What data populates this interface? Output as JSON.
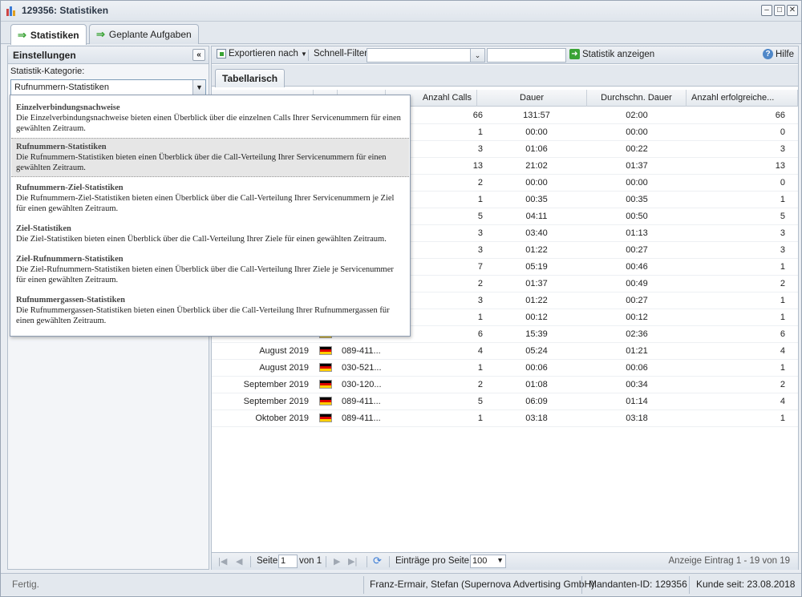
{
  "window": {
    "title": "129356: Statistiken"
  },
  "tabs": [
    {
      "label": "Statistiken",
      "active": true
    },
    {
      "label": "Geplante Aufgaben",
      "active": false
    }
  ],
  "settings": {
    "header": "Einstellungen",
    "category_label": "Statistik-Kategorie:",
    "selected": "Rufnummern-Statistiken"
  },
  "dropdown": [
    {
      "title": "Einzelverbindungsnachweise",
      "desc": "Die Einzelverbindungsnachweise bieten einen Überblick über die einzelnen Calls Ihrer Servicenummern für einen gewählten Zeitraum."
    },
    {
      "title": "Rufnummern-Statistiken",
      "desc": "Die Rufnummern-Statistiken bieten einen Überblick über die Call-Verteilung Ihrer Servicenummern für einen gewählten Zeitraum."
    },
    {
      "title": "Rufnummern-Ziel-Statistiken",
      "desc": "Die Rufnummern-Ziel-Statistiken bieten einen Überblick über die Call-Verteilung Ihrer Servicenummern je Ziel für einen gewählten Zeitraum."
    },
    {
      "title": "Ziel-Statistiken",
      "desc": "Die Ziel-Statistiken bieten einen Überblick über die Call-Verteilung Ihrer Ziele für einen gewählten Zeitraum."
    },
    {
      "title": "Ziel-Rufnummern-Statistiken",
      "desc": "Die Ziel-Rufnummern-Statistiken bieten einen Überblick über die Call-Verteilung Ihrer Ziele je Servicenummer für einen gewählten Zeitraum."
    },
    {
      "title": "Rufnummergassen-Statistiken",
      "desc": "Die Rufnummergassen-Statistiken bieten einen Überblick über die Call-Verteilung Ihrer Rufnummergassen für einen gewählten Zeitraum."
    }
  ],
  "toolbar": {
    "export": "Exportieren nach",
    "quickfilter": "Schnell-Filter",
    "show_stats": "Statistik anzeigen",
    "help": "Hilfe"
  },
  "subtab": "Tabellarisch",
  "columns": [
    "Anzahl Calls",
    "Dauer",
    "Durchschn. Dauer",
    "Anzahl erfolgreiche..."
  ],
  "rows": [
    {
      "period": "",
      "number": "",
      "calls": "66",
      "duration": "131:57",
      "avg": "02:00",
      "success": "66",
      "flag": false
    },
    {
      "period": "",
      "number": "",
      "calls": "1",
      "duration": "00:00",
      "avg": "00:00",
      "success": "0",
      "flag": false
    },
    {
      "period": "",
      "number": "",
      "calls": "3",
      "duration": "01:06",
      "avg": "00:22",
      "success": "3",
      "flag": false
    },
    {
      "period": "",
      "number": "",
      "calls": "13",
      "duration": "21:02",
      "avg": "01:37",
      "success": "13",
      "flag": false
    },
    {
      "period": "",
      "number": "",
      "calls": "2",
      "duration": "00:00",
      "avg": "00:00",
      "success": "0",
      "flag": false
    },
    {
      "period": "",
      "number": "",
      "calls": "1",
      "duration": "00:35",
      "avg": "00:35",
      "success": "1",
      "flag": false
    },
    {
      "period": "",
      "number": "",
      "calls": "5",
      "duration": "04:11",
      "avg": "00:50",
      "success": "5",
      "flag": false
    },
    {
      "period": "",
      "number": "",
      "calls": "3",
      "duration": "03:40",
      "avg": "01:13",
      "success": "3",
      "flag": false
    },
    {
      "period": "",
      "number": "",
      "calls": "3",
      "duration": "01:22",
      "avg": "00:27",
      "success": "3",
      "flag": false
    },
    {
      "period": "",
      "number": "",
      "calls": "7",
      "duration": "05:19",
      "avg": "00:46",
      "success": "1",
      "flag": false
    },
    {
      "period": "",
      "number": "",
      "calls": "2",
      "duration": "01:37",
      "avg": "00:49",
      "success": "2",
      "flag": false
    },
    {
      "period": "",
      "number": "",
      "calls": "3",
      "duration": "01:22",
      "avg": "00:27",
      "success": "1",
      "flag": false
    },
    {
      "period": "",
      "number": "",
      "calls": "1",
      "duration": "00:12",
      "avg": "00:12",
      "success": "1",
      "flag": false
    },
    {
      "period": "",
      "number": "",
      "calls": "6",
      "duration": "15:39",
      "avg": "02:36",
      "success": "6",
      "flag": true
    },
    {
      "period": "August 2019",
      "number": "089-411...",
      "calls": "4",
      "duration": "05:24",
      "avg": "01:21",
      "success": "4",
      "flag": true
    },
    {
      "period": "August 2019",
      "number": "030-521...",
      "calls": "1",
      "duration": "00:06",
      "avg": "00:06",
      "success": "1",
      "flag": true
    },
    {
      "period": "September 2019",
      "number": "030-120...",
      "calls": "2",
      "duration": "01:08",
      "avg": "00:34",
      "success": "2",
      "flag": true
    },
    {
      "period": "September 2019",
      "number": "089-411...",
      "calls": "5",
      "duration": "06:09",
      "avg": "01:14",
      "success": "4",
      "flag": true
    },
    {
      "period": "Oktober 2019",
      "number": "089-411...",
      "calls": "1",
      "duration": "03:18",
      "avg": "03:18",
      "success": "1",
      "flag": true
    }
  ],
  "pager": {
    "page_label": "Seite",
    "page": "1",
    "of_label": "von 1",
    "per_page_label": "Einträge pro Seite:",
    "per_page": "100",
    "info": "Anzeige Eintrag 1 - 19 von 19"
  },
  "status": {
    "state": "Fertig.",
    "user": "Franz-Ermair, Stefan (Supernova Advertising GmbH)",
    "client_id": "Mandanten-ID: 129356",
    "customer_since": "Kunde seit: 23.08.2018"
  }
}
